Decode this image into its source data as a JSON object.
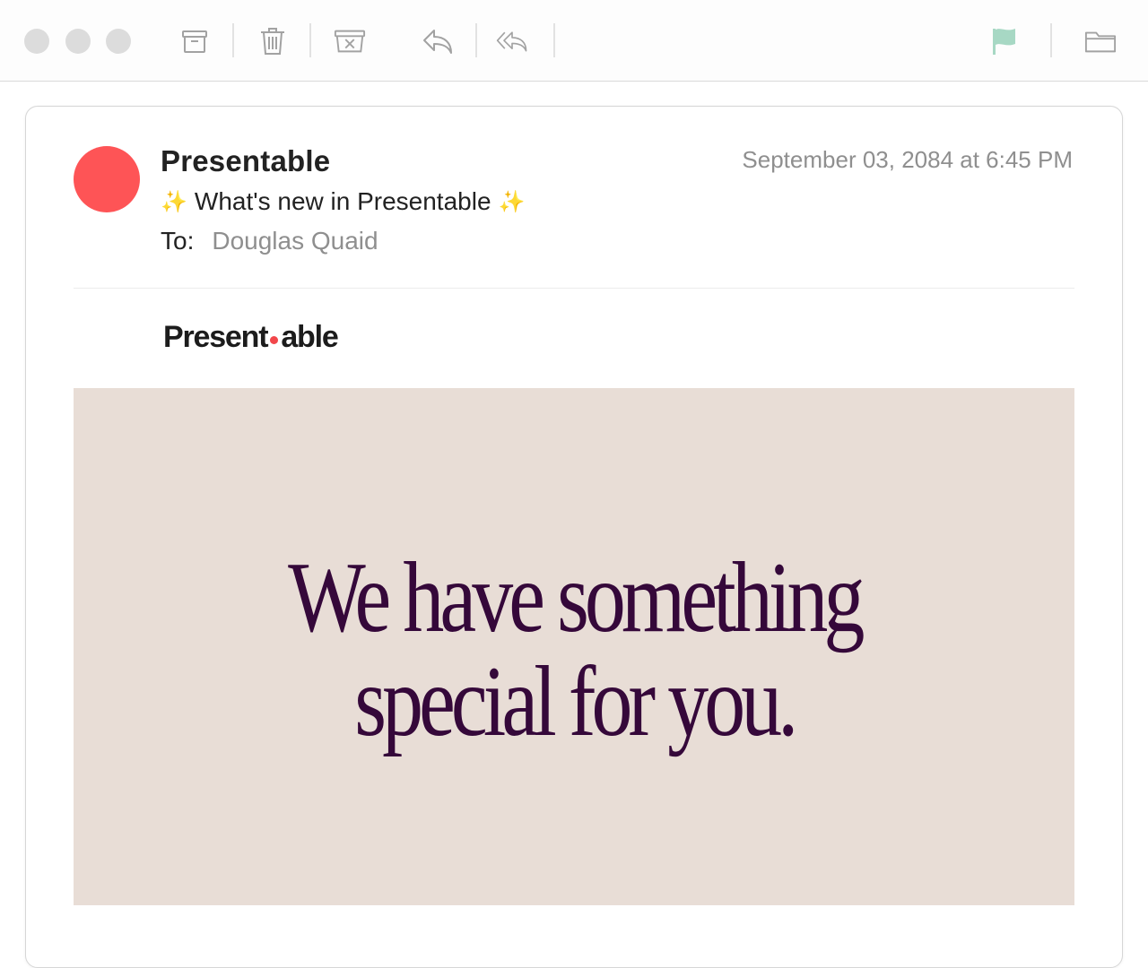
{
  "toolbar": {
    "window_controls": [
      "close",
      "minimize",
      "zoom"
    ],
    "buttons": [
      {
        "icon": "archive-icon"
      },
      {
        "icon": "trash-icon"
      },
      {
        "icon": "junk-icon"
      },
      {
        "icon": "reply-icon"
      },
      {
        "icon": "reply-all-icon"
      },
      {
        "icon": "flag-icon"
      },
      {
        "icon": "folder-icon"
      }
    ],
    "flag_color": "#a7d8c4"
  },
  "email": {
    "sender": "Presentable",
    "avatar_color": "#fe5456",
    "date": "September 03, 2084 at 6:45 PM",
    "subject": "What's new in Presentable",
    "subject_sparkle": "✨",
    "to_label": "To:",
    "to_value": "Douglas Quaid"
  },
  "body": {
    "logo_left": "Present",
    "logo_right": "able",
    "logo_dot_color": "#f2474b",
    "hero_background": "#e8ddd6",
    "hero_text_color": "#35083a",
    "hero_line1": "We have something",
    "hero_line2": "special for you."
  }
}
